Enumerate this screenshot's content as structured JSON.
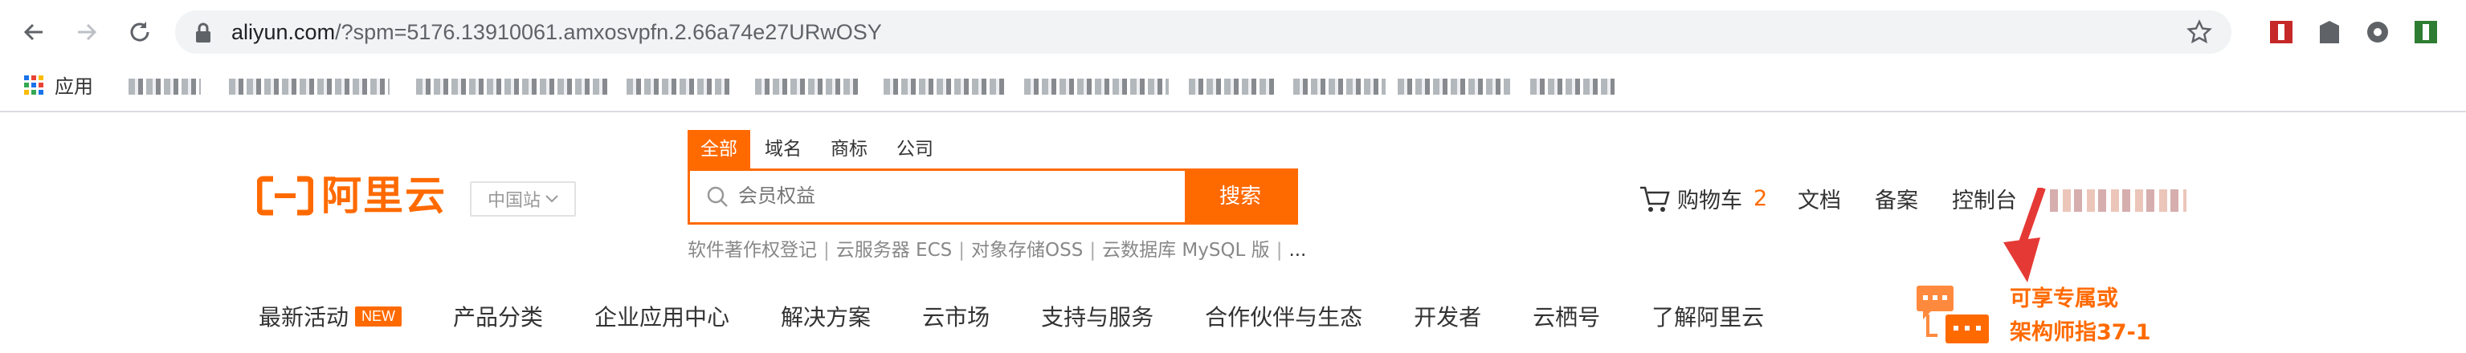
{
  "browser": {
    "url_host": "aliyun.com",
    "url_rest": "/?spm=5176.13910061.amxosvpfn.2.66a74e27URwOSY",
    "bookmarks_apps_label": "应用"
  },
  "site": {
    "logo_text": "阿里云",
    "region_label": "中国站",
    "search_tabs": [
      "全部",
      "域名",
      "商标",
      "公司"
    ],
    "search_placeholder": "会员权益",
    "search_button": "搜索",
    "hot_links": [
      "软件著作权登记",
      "云服务器 ECS",
      "对象存储OSS",
      "云数据库 MySQL 版"
    ],
    "hot_more": "...",
    "cart_label": "购物车",
    "cart_count": "2",
    "docs_label": "文档",
    "record_label": "备案",
    "console_label": "控制台",
    "nav": [
      "最新活动",
      "产品分类",
      "企业应用中心",
      "解决方案",
      "云市场",
      "支持与服务",
      "合作伙伴与生态",
      "开发者",
      "云栖号",
      "了解阿里云"
    ],
    "nav_badge": "NEW",
    "promo_line1": "可享专属或",
    "promo_line2": "架构师指37-1"
  },
  "colors": {
    "brand": "#ff6a00",
    "arrow": "#e53935"
  }
}
